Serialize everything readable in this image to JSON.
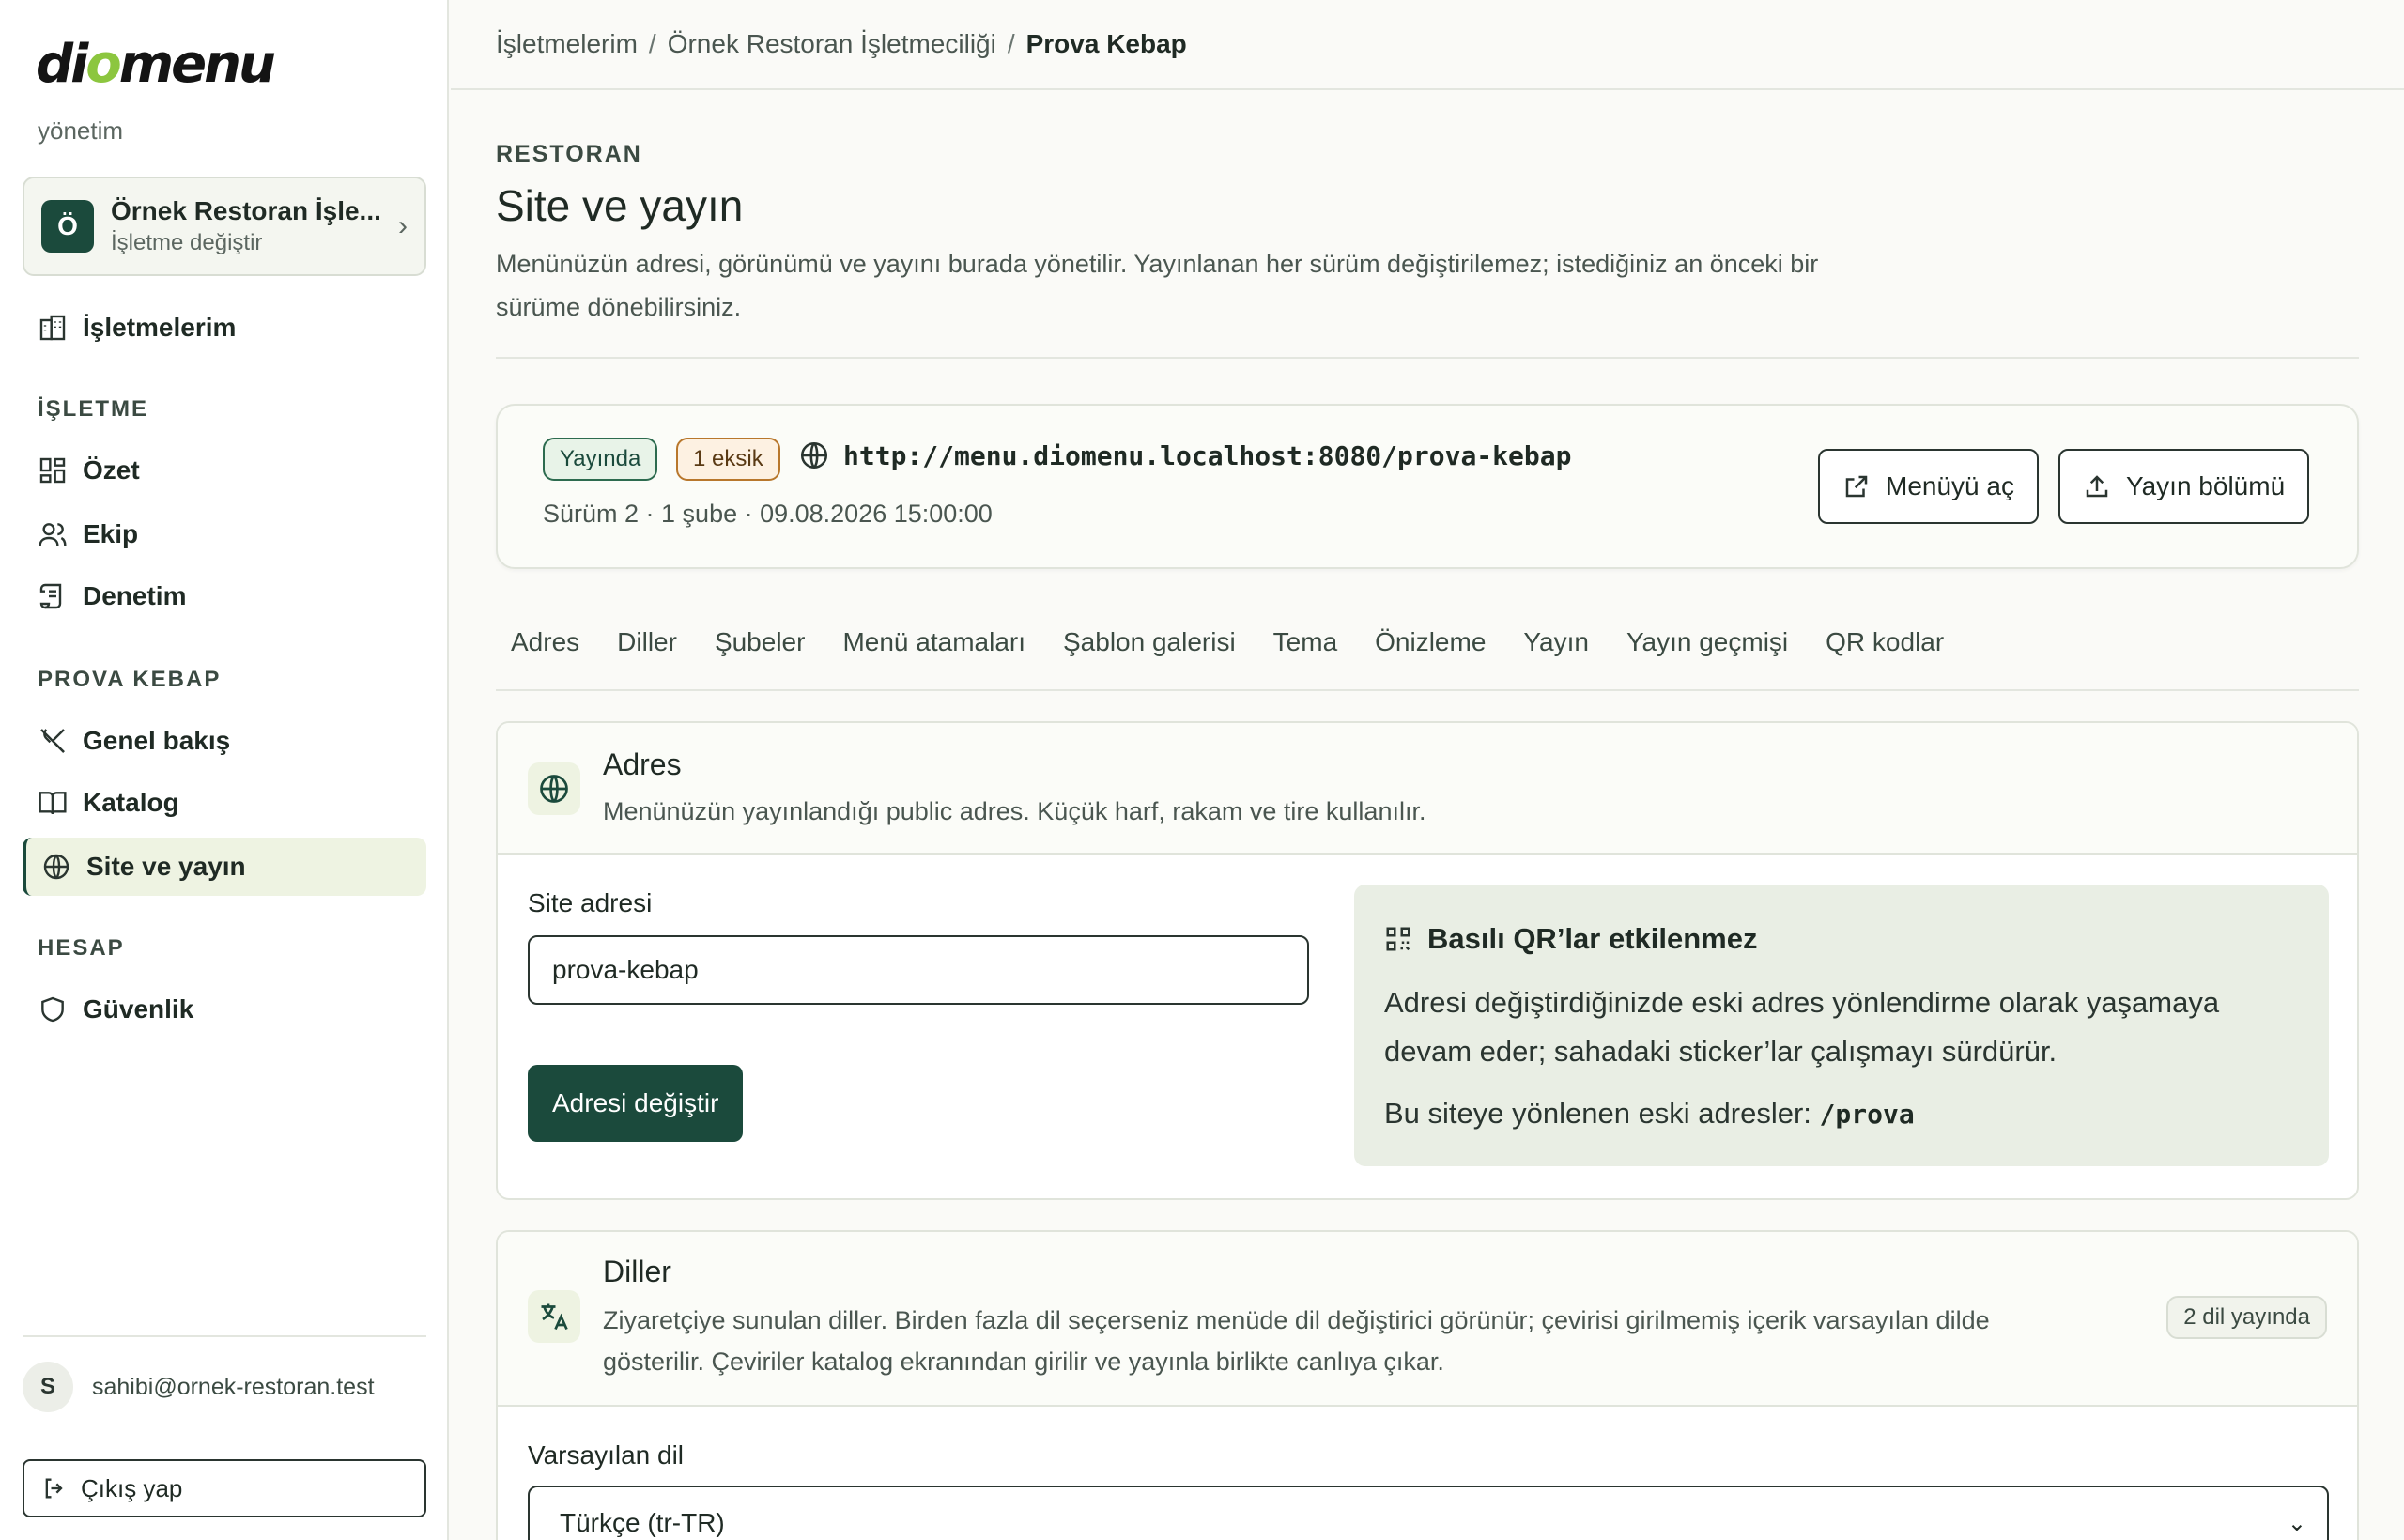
{
  "sidebar": {
    "logo_text_1": "di",
    "logo_text_o": "o",
    "logo_text_2": "menu",
    "logo_sub": "yönetim",
    "business": {
      "avatar": "Ö",
      "name": "Örnek Restoran İşle...",
      "sub": "İşletme değiştir"
    },
    "top_item": "İşletmelerim",
    "section_business": "İŞLETME",
    "business_items": [
      "Özet",
      "Ekip",
      "Denetim"
    ],
    "section_venue": "PROVA KEBAP",
    "venue_items": [
      "Genel bakış",
      "Katalog",
      "Site ve yayın"
    ],
    "section_account": "HESAP",
    "account_items": [
      "Güvenlik"
    ],
    "user_initial": "S",
    "user_email": "sahibi@ornek-restoran.test",
    "logout": "Çıkış yap"
  },
  "breadcrumb": {
    "items": [
      "İşletmelerim",
      "Örnek Restoran İşletmeciliği",
      "Prova Kebap"
    ],
    "separator": "/"
  },
  "page": {
    "label": "RESTORAN",
    "title": "Site ve yayın",
    "description": "Menünüzün adresi, görünümü ve yayını burada yönetilir. Yayınlanan her sürüm değiştirilemez; istediğiniz an önceki bir sürüme dönebilirsiniz."
  },
  "status": {
    "badge_live": "Yayında",
    "badge_missing": "1 eksik",
    "url": "http://menu.diomenu.localhost:8080/prova-kebap",
    "meta": "Sürüm 2 · 1 şube · 09.08.2026 15:00:00",
    "open_menu": "Menüyü aç",
    "publish_section": "Yayın bölümü"
  },
  "tabs": [
    "Adres",
    "Diller",
    "Şubeler",
    "Menü atamaları",
    "Şablon galerisi",
    "Tema",
    "Önizleme",
    "Yayın",
    "Yayın geçmişi",
    "QR kodlar"
  ],
  "address": {
    "title": "Adres",
    "description": "Menünüzün yayınlandığı public adres. Küçük harf, rakam ve tire kullanılır.",
    "field_label": "Site adresi",
    "field_value": "prova-kebap",
    "button": "Adresi değiştir",
    "info_title": "Basılı QR’lar etkilenmez",
    "info_body": "Adresi değiştirdiğinizde eski adres yönlendirme olarak yaşamaya devam eder; sahadaki sticker’lar çalışmayı sürdürür.",
    "info_redirects_label": "Bu siteye yönlenen eski adresler:",
    "info_redirects_value": "/prova"
  },
  "languages": {
    "title": "Diller",
    "description": "Ziyaretçiye sunulan diller. Birden fazla dil seçerseniz menüde dil değiştirici görünür; çevirisi girilmemiş içerik varsayılan dilde gösterilir. Çeviriler katalog ekranından girilir ve yayınla birlikte canlıya çıkar.",
    "count_badge": "2 dil yayında",
    "default_label": "Varsayılan dil",
    "default_value": "Türkçe (tr-TR)"
  }
}
